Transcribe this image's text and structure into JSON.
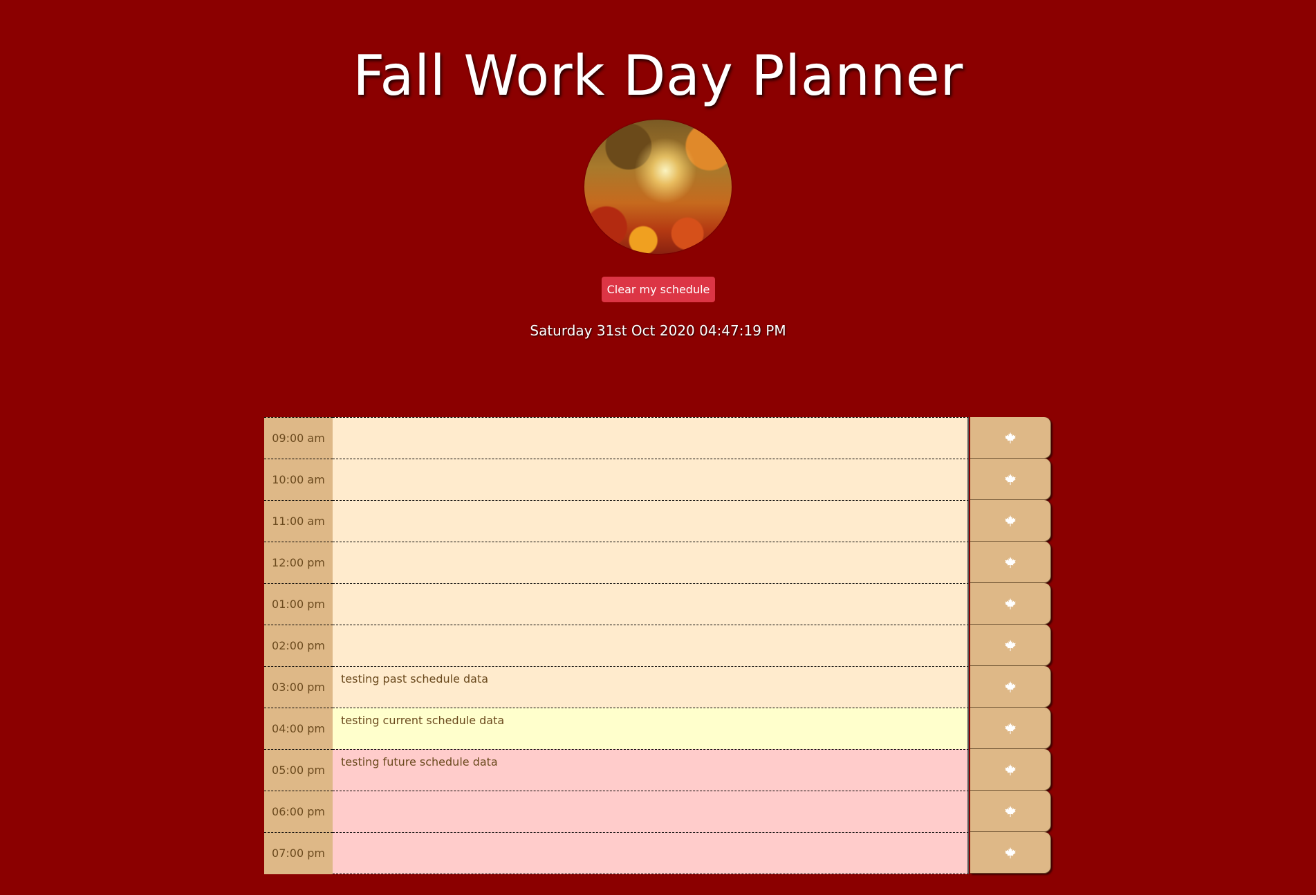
{
  "header": {
    "title": "Fall Work Day Planner",
    "clear_label": "Clear my schedule",
    "current_datetime": "Saturday 31st Oct 2020 04:47:19 PM"
  },
  "colors": {
    "background": "#8b0000",
    "hour_cell": "#deb887",
    "past": "#ffebcd",
    "present": "#ffffcc",
    "future": "#ffcccb",
    "clear_button": "#dc3545"
  },
  "icons": {
    "hero": "autumn-leaves-image",
    "save": "maple-leaf-icon"
  },
  "timeblocks": [
    {
      "hour": "09:00 am",
      "text": "",
      "status": "past"
    },
    {
      "hour": "10:00 am",
      "text": "",
      "status": "past"
    },
    {
      "hour": "11:00 am",
      "text": "",
      "status": "past"
    },
    {
      "hour": "12:00 pm",
      "text": "",
      "status": "past"
    },
    {
      "hour": "01:00 pm",
      "text": "",
      "status": "past"
    },
    {
      "hour": "02:00 pm",
      "text": "",
      "status": "past"
    },
    {
      "hour": "03:00 pm",
      "text": "testing past schedule data",
      "status": "past"
    },
    {
      "hour": "04:00 pm",
      "text": "testing current schedule data",
      "status": "present"
    },
    {
      "hour": "05:00 pm",
      "text": "testing future  schedule data",
      "status": "future"
    },
    {
      "hour": "06:00 pm",
      "text": "",
      "status": "future"
    },
    {
      "hour": "07:00 pm",
      "text": "",
      "status": "future"
    }
  ]
}
